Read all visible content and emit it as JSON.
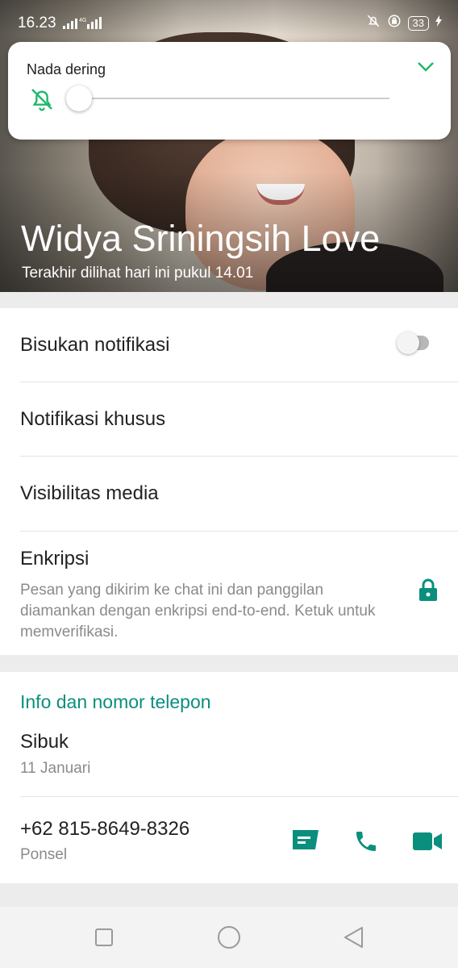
{
  "status_bar": {
    "time": "16.23",
    "network": "4G",
    "battery": "33"
  },
  "volume_popup": {
    "label": "Nada dering",
    "level": 0,
    "icon": "bell-off-icon",
    "collapse_icon": "chevron-down-icon"
  },
  "contact": {
    "name": "Widya Sriningsih Love",
    "last_seen": "Terakhir dilihat hari ini pukul 14.01"
  },
  "settings": {
    "mute_label": "Bisukan notifikasi",
    "mute_on": false,
    "custom_notif_label": "Notifikasi khusus",
    "media_visibility_label": "Visibilitas media",
    "encryption_label": "Enkripsi",
    "encryption_desc": "Pesan yang dikirim ke chat ini dan panggilan diamankan dengan enkripsi end-to-end. Ketuk untuk memverifikasi."
  },
  "info": {
    "section_title": "Info dan nomor telepon",
    "about": "Sibuk",
    "about_date": "11 Januari",
    "phone": "+62 815-8649-8326",
    "phone_type": "Ponsel"
  },
  "colors": {
    "accent": "#0a8f7d",
    "popup_accent": "#1fb86b"
  }
}
